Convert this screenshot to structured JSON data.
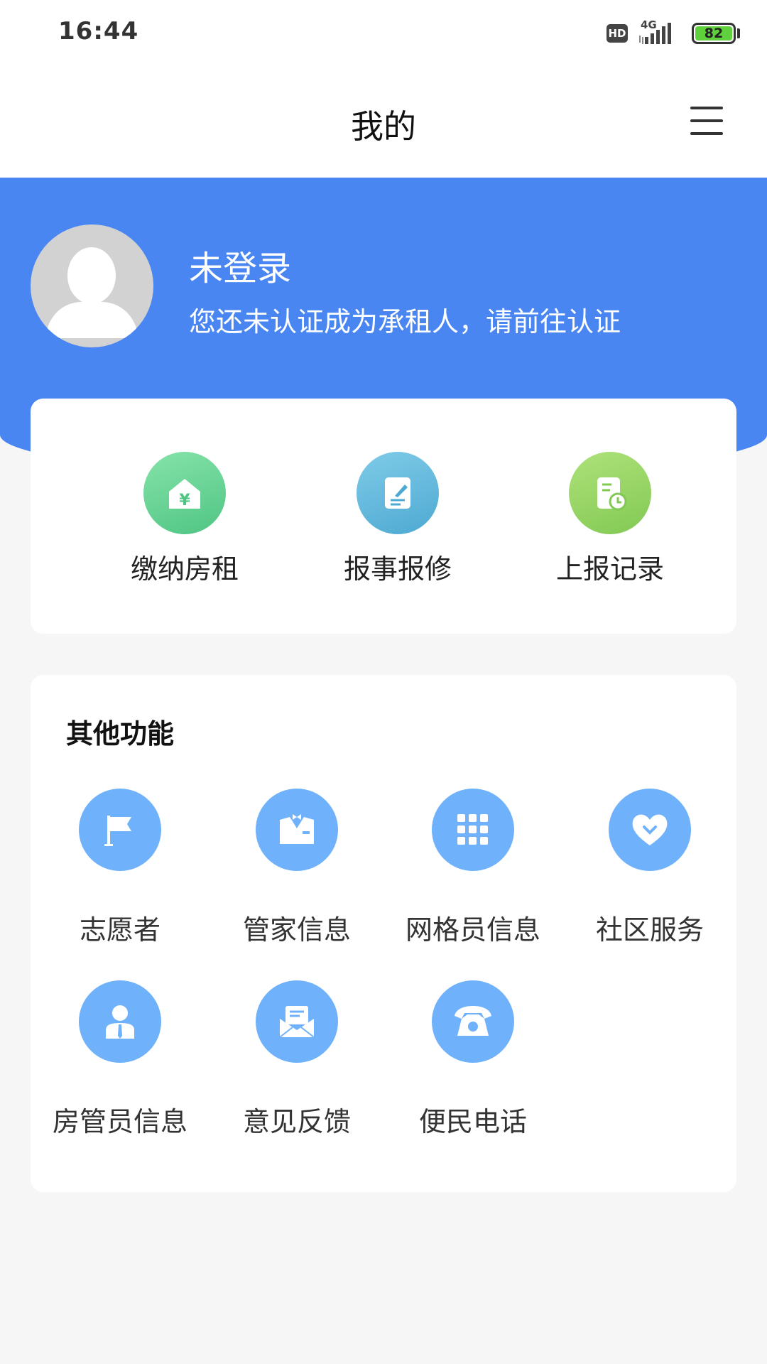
{
  "status_bar": {
    "time": "16:44",
    "hd_badge": "HD",
    "network": "4G",
    "battery": "82"
  },
  "nav": {
    "title": "我的"
  },
  "profile": {
    "name": "未登录",
    "subtitle": "您还未认证成为承租人，请前往认证"
  },
  "quick_actions": [
    {
      "label": "缴纳房租",
      "icon": "house-yuan-icon"
    },
    {
      "label": "报事报修",
      "icon": "edit-document-icon"
    },
    {
      "label": "上报记录",
      "icon": "record-clock-icon"
    }
  ],
  "other_functions": {
    "title": "其他功能",
    "items": [
      {
        "label": "志愿者",
        "icon": "flag-icon"
      },
      {
        "label": "管家信息",
        "icon": "butler-icon"
      },
      {
        "label": "网格员信息",
        "icon": "grid-icon"
      },
      {
        "label": "社区服务",
        "icon": "heart-icon"
      },
      {
        "label": "房管员信息",
        "icon": "person-icon"
      },
      {
        "label": "意见反馈",
        "icon": "mail-icon"
      },
      {
        "label": "便民电话",
        "icon": "telephone-icon"
      }
    ]
  },
  "colors": {
    "header_blue": "#4a86f2",
    "function_icon_blue": "#6fb2fb",
    "pay_rent_green": "#5fd08f",
    "repair_teal": "#5cb6dc",
    "record_lime": "#93d562"
  }
}
